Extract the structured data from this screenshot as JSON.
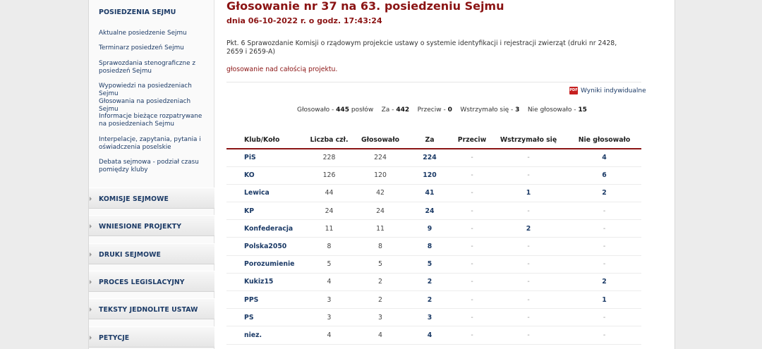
{
  "sidebar": {
    "heading": "POSIEDZENIA SEJMU",
    "links": [
      "Aktualne posiedzenie Sejmu",
      "Terminarz posiedzeń Sejmu",
      "Sprawozdania stenograficzne z posiedzeń Sejmu",
      "Wypowiedzi na posiedzeniach Sejmu",
      "Głosowania na posiedzeniach Sejmu",
      "Informacje bieżące rozpatrywane na posiedzeniach Sejmu",
      "Interpelacje, zapytania, pytania i oświadczenia poselskie",
      "Debata sejmowa - podział czasu pomiędzy kluby"
    ],
    "sections": [
      "KOMISJE SEJMOWE",
      "WNIESIONE PROJEKTY",
      "DRUKI SEJMOWE",
      "PROCES LEGISLACYJNY",
      "TEKSTY JEDNOLITE USTAW",
      "PETYCJE"
    ]
  },
  "main": {
    "title": "Głosowanie nr 37 na 63. posiedzeniu Sejmu",
    "subtitle": "dnia 06-10-2022 r. o godz. 17:43:24",
    "item": "Pkt. 6 Sprawozdanie Komisji o rządowym projekcie ustawy o systemie identyfikacji i rejestracji zwierząt (druki nr 2428, 2659 i 2659-A)",
    "note": "głosowanie nad całością projektu.",
    "individual_results": "Wyniki indywidualne",
    "pdf_icon": "PDF",
    "summary": {
      "voted_label": "Głosowało -",
      "voted": "445",
      "mps": "posłów",
      "for_label": "Za -",
      "for": "442",
      "against_label": "Przeciw -",
      "against": "0",
      "abstain_label": "Wstrzymało się -",
      "abstain": "3",
      "notvoted_label": "Nie głosowało -",
      "notvoted": "15"
    }
  },
  "table": {
    "headers": [
      "Klub/Koło",
      "Liczba czł.",
      "Głosowało",
      "Za",
      "Przeciw",
      "Wstrzymało się",
      "Nie głosowało"
    ],
    "rows": [
      [
        "PiS",
        "228",
        "224",
        "224",
        "-",
        "-",
        "4"
      ],
      [
        "KO",
        "126",
        "120",
        "120",
        "-",
        "-",
        "6"
      ],
      [
        "Lewica",
        "44",
        "42",
        "41",
        "-",
        "1",
        "2"
      ],
      [
        "KP",
        "24",
        "24",
        "24",
        "-",
        "-",
        "-"
      ],
      [
        "Konfederacja",
        "11",
        "11",
        "9",
        "-",
        "2",
        "-"
      ],
      [
        "Polska2050",
        "8",
        "8",
        "8",
        "-",
        "-",
        "-"
      ],
      [
        "Porozumienie",
        "5",
        "5",
        "5",
        "-",
        "-",
        "-"
      ],
      [
        "Kukiz15",
        "4",
        "2",
        "2",
        "-",
        "-",
        "2"
      ],
      [
        "PPS",
        "3",
        "2",
        "2",
        "-",
        "-",
        "1"
      ],
      [
        "PS",
        "3",
        "3",
        "3",
        "-",
        "-",
        "-"
      ],
      [
        "niez.",
        "4",
        "4",
        "4",
        "-",
        "-",
        "-"
      ]
    ]
  },
  "colors": {
    "accent": "#8b1414",
    "link": "#1b3a66"
  }
}
